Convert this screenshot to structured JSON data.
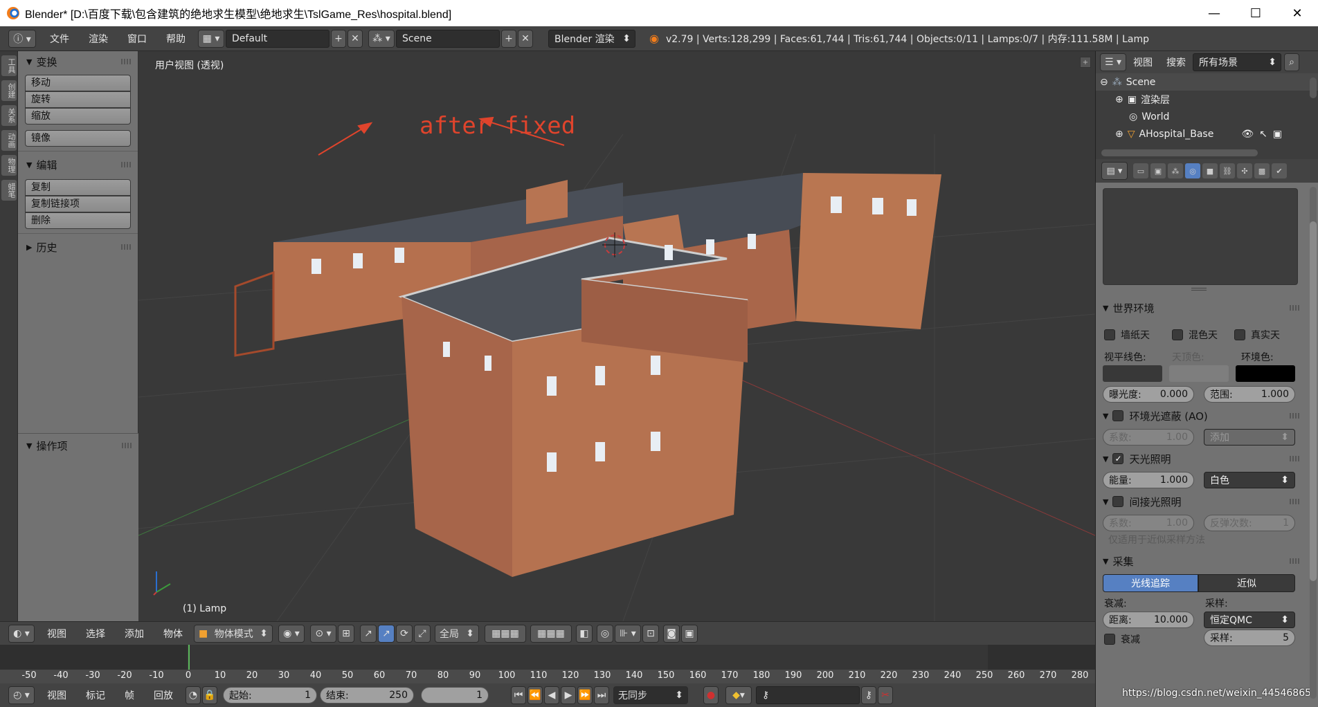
{
  "titlebar": {
    "title": "Blender* [D:\\百度下载\\包含建筑的绝地求生模型\\绝地求生\\TslGame_Res\\hospital.blend]",
    "minimize": "—",
    "maximize": "☐",
    "close": "✕"
  },
  "infobar": {
    "menus": [
      "文件",
      "渲染",
      "窗口",
      "帮助"
    ],
    "layout": "Default",
    "scene": "Scene",
    "engine": "Blender 渲染",
    "stats": "v2.79 | Verts:128,299 | Faces:61,744 | Tris:61,744 | Objects:0/11 | Lamps:0/7 | 内存:111.58M | Lamp"
  },
  "lefttabs": [
    "工具",
    "创建",
    "关系",
    "动画",
    "物理",
    "蜡笔"
  ],
  "toolshelf": {
    "transform": {
      "title": "变换",
      "buttons": [
        "移动",
        "旋转",
        "缩放"
      ],
      "mirror": "镜像"
    },
    "edit": {
      "title": "编辑",
      "buttons": [
        "复制",
        "复制链接项",
        "删除"
      ]
    },
    "history": {
      "title": "历史"
    },
    "operator": {
      "title": "操作项"
    }
  },
  "viewport": {
    "view_label": "用户视图 (透视)",
    "object_label": "(1) Lamp",
    "annotation": "after fixed",
    "annotation_color": "#e0442c"
  },
  "viewheader": {
    "menus": [
      "视图",
      "选择",
      "添加",
      "物体"
    ],
    "mode": "物体模式",
    "pivot": "全局"
  },
  "timeline": {
    "ticks": [
      -50,
      -40,
      -30,
      -20,
      -10,
      0,
      10,
      20,
      30,
      40,
      50,
      60,
      70,
      80,
      90,
      100,
      110,
      120,
      130,
      140,
      150,
      160,
      170,
      180,
      190,
      200,
      210,
      220,
      230,
      240,
      250,
      260,
      270,
      280
    ],
    "menus": [
      "视图",
      "标记",
      "帧",
      "回放"
    ],
    "start_label": "起始:",
    "start": "1",
    "end_label": "结束:",
    "end": "250",
    "current": "1",
    "sync": "无同步"
  },
  "outliner": {
    "view": "视图",
    "search": "搜索",
    "filter": "所有场景",
    "rows": [
      "Scene",
      "渲染层",
      "World",
      "AHospital_Base"
    ]
  },
  "properties": {
    "world_env": {
      "title": "世界环境",
      "paper": "墙纸天",
      "blend": "混色天",
      "real": "真实天",
      "horizon": "视平线色:",
      "zenith": "天顶色:",
      "ambient": "环境色:",
      "exposure_label": "曝光度:",
      "exposure": "0.000",
      "range_label": "范围:",
      "range": "1.000"
    },
    "ao": {
      "title": "环境光遮蔽 (AO)",
      "factor_label": "系数:",
      "factor": "1.00",
      "mode": "添加"
    },
    "env_light": {
      "title": "天光照明",
      "energy_label": "能量:",
      "energy": "1.000",
      "color": "白色"
    },
    "indirect": {
      "title": "间接光照明",
      "factor_label": "系数:",
      "factor": "1.00",
      "bounces_label": "反弹次数:",
      "bounces": "1",
      "note": "仅适用于近似采样方法"
    },
    "gather": {
      "title": "采集",
      "raytrace": "光线追踪",
      "approx": "近似",
      "attenuation": "衰减:",
      "sampling": "采样:",
      "distance_label": "距离:",
      "distance": "10.000",
      "method": "恒定QMC",
      "falloff": "衰减",
      "samples_label": "采样:",
      "samples": "5",
      "watermark": "https://blog.csdn.net/weixin_44546865"
    }
  }
}
